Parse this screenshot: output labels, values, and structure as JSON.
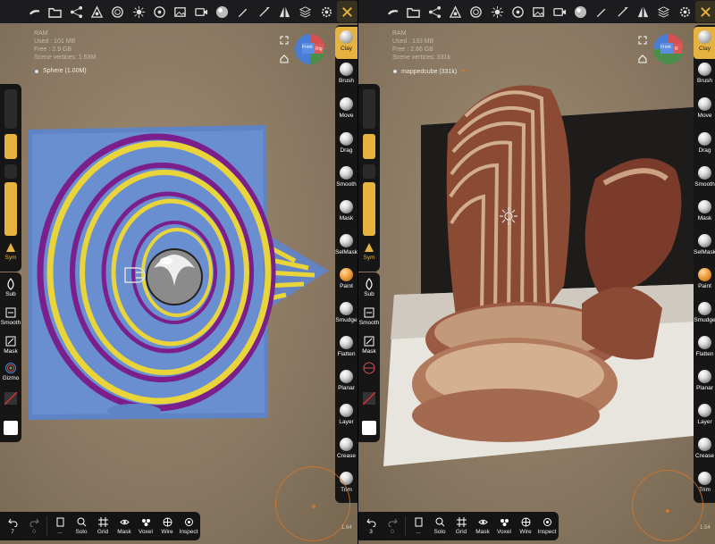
{
  "top_toolbar": {
    "icons": [
      "open-icon",
      "folder-icon",
      "scene-icon",
      "shapes-icon",
      "mesh-icon",
      "sun-icon",
      "camera-icon",
      "image-icon",
      "video-icon",
      "material-icon",
      "brush-icon",
      "stroke-icon",
      "symmetry-icon",
      "layers-icon",
      "settings-icon",
      "tools-icon"
    ]
  },
  "left_view": {
    "scene_info": {
      "line1": "RAM",
      "line2": "Used : 101 MB",
      "line3": "Free : 2.9 GB",
      "line4": "Scene vertices: 1.63M"
    },
    "mesh_name": "Sphere (1.00M)",
    "cube": {
      "front": "Front",
      "side": "Rig"
    },
    "sym_label": "Sym",
    "sub_label": "Sub",
    "smooth_label": "Smooth",
    "mask_label": "Mask",
    "gizmo_label": "Gizmo",
    "undo_count": "7",
    "redo_count": "0",
    "zoom_value": "1.64"
  },
  "right_view": {
    "scene_info": {
      "line1": "RAM",
      "line2": "Used : 133 MB",
      "line3": "Free : 2.66 GB",
      "line4": "Scene vertices: 331k"
    },
    "mesh_name": "mappedcube (331k)",
    "cube": {
      "front": "Front",
      "side": "R"
    },
    "sym_label": "Sym",
    "sub_label": "Sub",
    "smooth_label": "Smooth",
    "mask_label": "Mask",
    "undo_count": "3",
    "redo_count": "0",
    "zoom_value": "1.54"
  },
  "tools": [
    {
      "label": "Clay",
      "active": true
    },
    {
      "label": "Brush"
    },
    {
      "label": "Move"
    },
    {
      "label": "Drag"
    },
    {
      "label": "Smooth"
    },
    {
      "label": "Mask"
    },
    {
      "label": "SelMask"
    },
    {
      "label": "Paint"
    },
    {
      "label": "Smudge"
    },
    {
      "label": "Flatten"
    },
    {
      "label": "Planar"
    },
    {
      "label": "Layer"
    },
    {
      "label": "Crease"
    },
    {
      "label": "Trim"
    }
  ],
  "bottom": {
    "file_label": "...",
    "solo": "Solo",
    "grid": "Grid",
    "mask": "Mask",
    "voxel": "Voxel",
    "wire": "Wire",
    "inspect": "Inspect"
  },
  "colors": {
    "accent": "#e6b340",
    "ring": "#d4762a",
    "spiral_yellow": "#e9d43a",
    "spiral_purple": "#7a1f8c",
    "plane_blue": "#5e84c6"
  }
}
